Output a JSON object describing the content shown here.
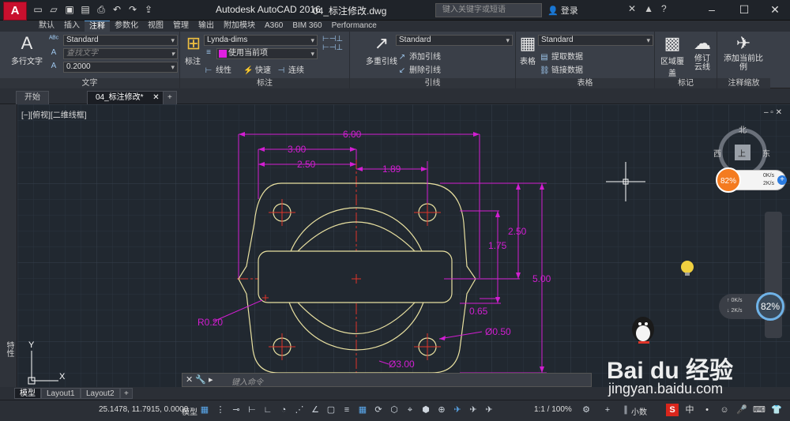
{
  "titlebar": {
    "logo": "A",
    "app_title": "Autodesk AutoCAD 2016",
    "file_title": "04_标注修改.dwg",
    "search_placeholder": "键入关键字或短语",
    "login": "登录",
    "minimize": "–",
    "maximize": "☐",
    "close": "✕",
    "qat_icons": [
      "new-icon",
      "open-icon",
      "save-icon",
      "saveas-icon",
      "print-icon",
      "undo-icon",
      "redo-icon",
      "share-icon"
    ]
  },
  "ribbon_tabs": [
    "默认",
    "插入",
    "注释",
    "参数化",
    "视图",
    "管理",
    "输出",
    "附加模块",
    "A360",
    "BIM 360",
    "Performance"
  ],
  "active_ribbon_tab": "注释",
  "ribbon": {
    "text_panel": {
      "big_button": "多行文字",
      "style_value": "Standard",
      "find_placeholder": "查找文字",
      "height_value": "0.2000",
      "label": "文字"
    },
    "dim_panel": {
      "big_button": "标注",
      "dimstyle_value": "Lynda-dims",
      "layer_value": "使用当前项",
      "row_linear": "线性",
      "row_quick": "快速",
      "row_continue": "连续",
      "label": "标注"
    },
    "leader_panel": {
      "big_button": "多重引线",
      "style_value": "Standard",
      "add_leader": "添加引线",
      "remove_leader": "删除引线",
      "label": "引线"
    },
    "table_panel": {
      "big_button": "表格",
      "style_value": "Standard",
      "extract": "提取数据",
      "link": "链接数据",
      "label": "表格"
    },
    "markup_panel": {
      "wipeout": "区域覆盖",
      "revcloud": "修订云线",
      "label": "标记"
    },
    "scale_panel": {
      "add_scale": "添加当前比例",
      "label": "注释缩放"
    }
  },
  "doc_tabs": [
    "开始",
    "04_标注修改*"
  ],
  "viewport_label": "[−][俯视][二维线框]",
  "viewport_controls": "– ▫ ✕",
  "left_palette_label": "特性",
  "drawing": {
    "dims": {
      "d600": "6.00",
      "d300": "3.00",
      "d250": "2.50",
      "d189": "1.89",
      "d250v": "2.50",
      "d175": "1.75",
      "d500": "5.00",
      "d065": "0.65",
      "r020": "R0.20",
      "dia050": "Ø0.50",
      "dia300": "Ø3.00"
    },
    "ucs_x": "X",
    "ucs_y": "Y"
  },
  "compass": {
    "north": "北",
    "west": "西",
    "east": "东",
    "top": "上"
  },
  "net_widget": {
    "percent": "82%",
    "up": "0K/s",
    "down": "2K/s"
  },
  "net_widget2": {
    "up": "0K/s",
    "down": "2K/s",
    "percent": "82%"
  },
  "cmdline_placeholder": "键入命令",
  "layout_tabs": [
    "模型",
    "Layout1",
    "Layout2"
  ],
  "statusbar": {
    "coords": "25.1478, 11.7915, 0.0000",
    "model": "模型",
    "scale": "1:1 / 100%",
    "units": "小数",
    "tray_lang": "中"
  },
  "watermark": {
    "brand": "Bai du 经验",
    "url": "jingyan.baidu.com"
  },
  "colors": {
    "dimension": "#d21ed2",
    "outline": "#e8e0a0",
    "centerline": "#e0352a",
    "canvas": "#212830"
  }
}
